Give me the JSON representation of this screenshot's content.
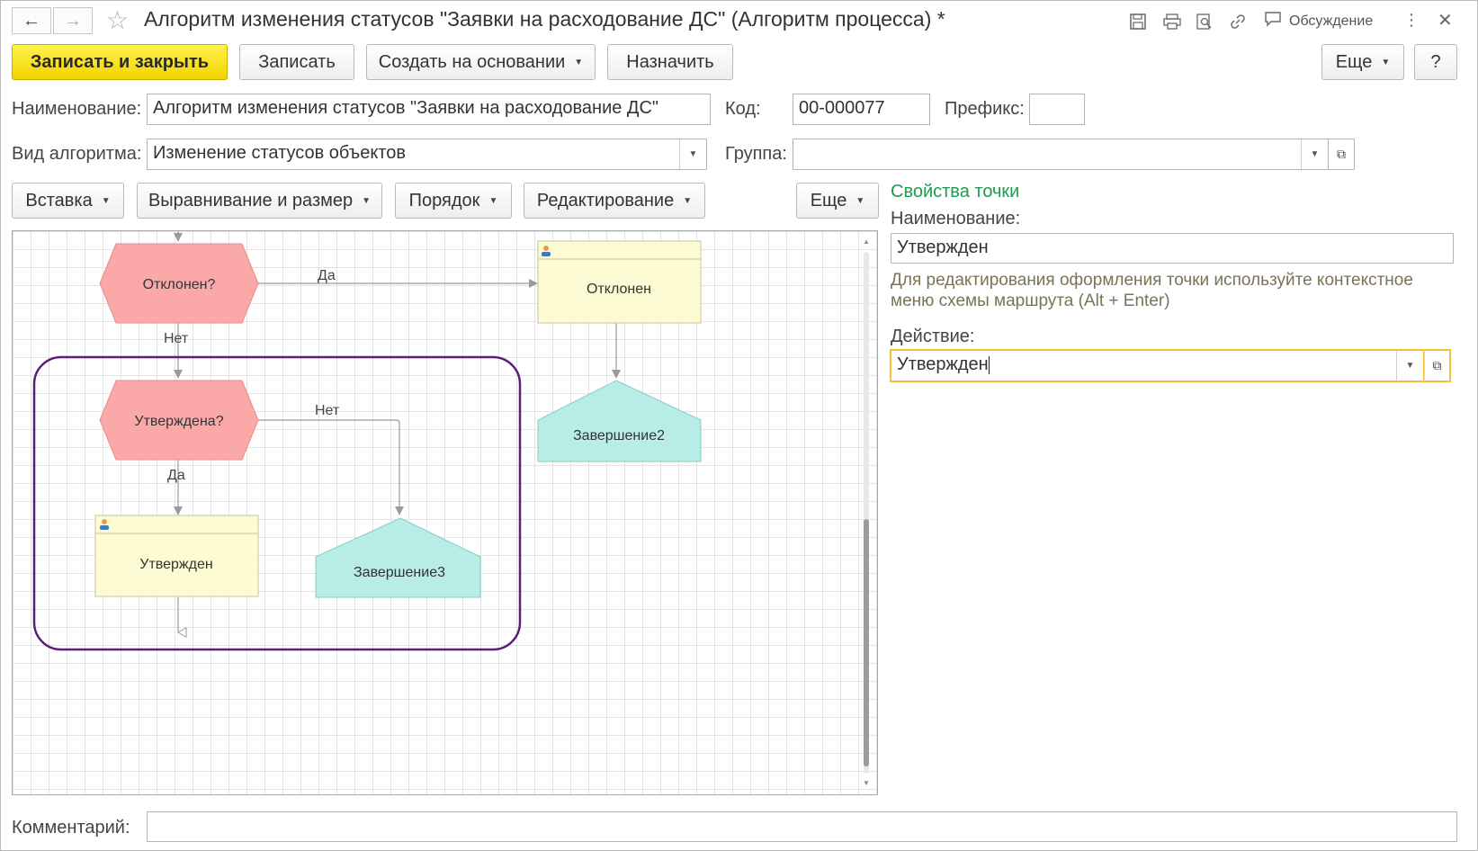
{
  "window": {
    "title": "Алгоритм изменения статусов \"Заявки на расходование ДС\" (Алгоритм процесса) *",
    "discussion_label": "Обсуждение"
  },
  "toolbar": {
    "save_close": "Записать и закрыть",
    "save": "Записать",
    "create_based": "Создать на основании",
    "assign": "Назначить",
    "more": "Еще",
    "help": "?"
  },
  "form": {
    "name_label": "Наименование:",
    "name_value": "Алгоритм изменения статусов \"Заявки на расходование ДС\"",
    "code_label": "Код:",
    "code_value": "00-000077",
    "prefix_label": "Префикс:",
    "prefix_value": "",
    "kind_label": "Вид алгоритма:",
    "kind_value": "Изменение статусов объектов",
    "group_label": "Группа:",
    "group_value": "",
    "comment_label": "Комментарий:",
    "comment_value": ""
  },
  "schema_toolbar": {
    "insert": "Вставка",
    "align_size": "Выравнивание и размер",
    "order": "Порядок",
    "editing": "Редактирование",
    "more": "Еще"
  },
  "diagram": {
    "nodes": {
      "rejected_q": "Отклонен?",
      "approved_q": "Утверждена?",
      "rejected": "Отклонен",
      "approved": "Утвержден",
      "end2": "Завершение2",
      "end3": "Завершение3"
    },
    "edges": {
      "yes_top": "Да",
      "no_top": "Нет",
      "no_mid": "Нет",
      "yes_mid": "Да"
    },
    "colors": {
      "condition": "#fba8a8",
      "action": "#fdfbd4",
      "end": "#b8ece7",
      "highlight": "#5b1f7a"
    }
  },
  "properties": {
    "title": "Свойства точки",
    "name_label": "Наименование:",
    "name_value": "Утвержден",
    "hint": "Для редактирования оформления точки используйте контекстное меню схемы маршрута (Alt + Enter)",
    "action_label": "Действие:",
    "action_value": "Утвержден"
  }
}
